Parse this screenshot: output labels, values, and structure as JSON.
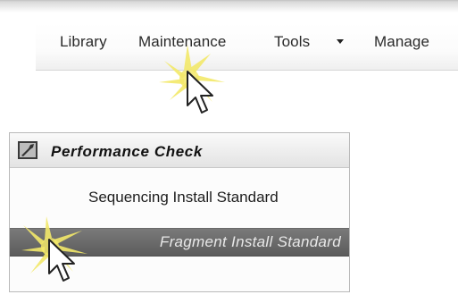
{
  "menubar": {
    "items": [
      {
        "label": "Library"
      },
      {
        "label": "Maintenance"
      },
      {
        "label": "Tools"
      },
      {
        "label": "Manage"
      }
    ]
  },
  "panel": {
    "title": "Performance Check",
    "icon": "wrench-icon",
    "items": [
      {
        "label": "Sequencing Install Standard",
        "selected": false
      },
      {
        "label": "Fragment Install Standard",
        "selected": true
      }
    ]
  },
  "colors": {
    "highlight": "#f3e96a",
    "selected_row": "#6b6b6b"
  }
}
